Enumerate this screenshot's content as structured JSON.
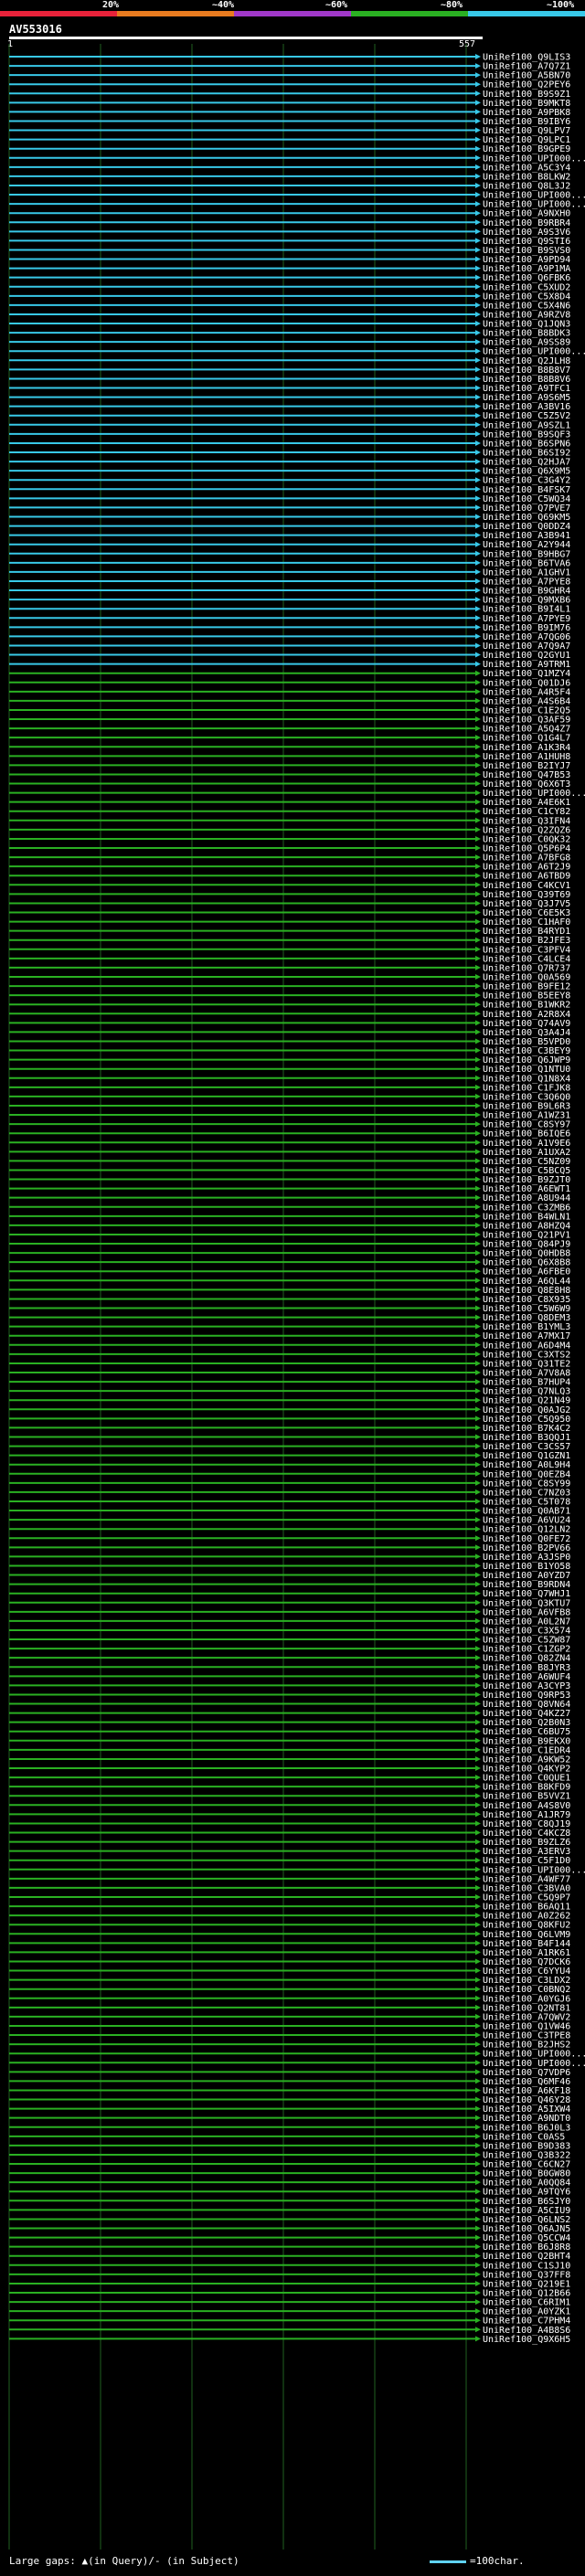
{
  "scale": {
    "labels": [
      "20%",
      "~40%",
      "~60%",
      "~80%",
      "~100%"
    ],
    "colors": [
      "#e8223a",
      "#e87b1f",
      "#a038c8",
      "#2ab022",
      "#38c8e8"
    ]
  },
  "query": {
    "name": "AV553016",
    "start": "1",
    "end": "557"
  },
  "legend": {
    "text": "Large gaps: ▲(in Query)/- (in Subject)",
    "scale_text": "=100char."
  },
  "chart_data": {
    "type": "alignment",
    "x_range": [
      1,
      557
    ],
    "blue_hits": [
      "UniRef100_Q9LIS3",
      "UniRef100_A7Q7Z1",
      "UniRef100_A5BN70",
      "UniRef100_Q2PEY6",
      "UniRef100_B9S9Z1",
      "UniRef100_B9MKT8",
      "UniRef100_A9PBK8",
      "UniRef100_B9IBY6",
      "UniRef100_Q9LPV7",
      "UniRef100_Q9LPC1",
      "UniRef100_B9GPE9",
      "UniRef100_UPI000...",
      "UniRef100_A5C3Y4",
      "UniRef100_B8LKW2",
      "UniRef100_Q8L3J2",
      "UniRef100_UPI000...",
      "UniRef100_UPI000...",
      "UniRef100_A9NXH0",
      "UniRef100_B9RBR4",
      "UniRef100_A9S3V6",
      "UniRef100_Q9STI6",
      "UniRef100_B9SVS0",
      "UniRef100_A9PD94",
      "UniRef100_A9P1MA",
      "UniRef100_Q6FBK6",
      "UniRef100_C5XUD2",
      "UniRef100_C5X8D4",
      "UniRef100_C5X4N6",
      "UniRef100_A9RZV8",
      "UniRef100_Q1JQN3",
      "UniRef100_B8BDK3",
      "UniRef100_A9SS89",
      "UniRef100_UPI000...",
      "UniRef100_Q2JLH8",
      "UniRef100_B8B8V7",
      "UniRef100_B8B8V6",
      "UniRef100_A9TFC1",
      "UniRef100_A9S6M5",
      "UniRef100_A3BV16",
      "UniRef100_C5Z5V2",
      "UniRef100_A9SZL1",
      "UniRef100_B9SQF3",
      "UniRef100_B6SPN6",
      "UniRef100_B6SI92",
      "UniRef100_Q2HJA7",
      "UniRef100_Q6X9M5",
      "UniRef100_C3G4Y2",
      "UniRef100_B4FSK7",
      "UniRef100_C5WQ34",
      "UniRef100_Q7PVE7",
      "UniRef100_Q69KM5",
      "UniRef100_Q0DDZ4",
      "UniRef100_A3B941",
      "UniRef100_A2Y944",
      "UniRef100_B9HBG7",
      "UniRef100_B6TVA6",
      "UniRef100_A1GHV1",
      "UniRef100_A7PYE8",
      "UniRef100_B9GHR4",
      "UniRef100_Q9MXB6",
      "UniRef100_B9I4L1",
      "UniRef100_A7PYE9",
      "UniRef100_B9IM76",
      "UniRef100_A7QG06",
      "UniRef100_A7Q9A7",
      "UniRef100_Q2GYU1",
      "UniRef100_A9TRM1"
    ],
    "green_hits": [
      "UniRef100_Q1MZY4",
      "UniRef100_Q01DJ6",
      "UniRef100_A4R5F4",
      "UniRef100_A4S6B4",
      "UniRef100_C1E2Q5",
      "UniRef100_Q3AF59",
      "UniRef100_A5Q4Z7",
      "UniRef100_Q1G4L7",
      "UniRef100_A1K3R4",
      "UniRef100_A1HUH8",
      "UniRef100_B2IYJ7",
      "UniRef100_Q47B53",
      "UniRef100_Q6X6T3",
      "UniRef100_UPI000...",
      "UniRef100_A4E6K1",
      "UniRef100_C1CY82",
      "UniRef100_Q3IFN4",
      "UniRef100_Q2ZQZ6",
      "UniRef100_C0QK32",
      "UniRef100_Q5P6P4",
      "UniRef100_A7BFG8",
      "UniRef100_A6T2J9",
      "UniRef100_A6TBD9",
      "UniRef100_C4KCV1",
      "UniRef100_Q39T69",
      "UniRef100_Q3J7V5",
      "UniRef100_C6E5K3",
      "UniRef100_C1HAF0",
      "UniRef100_B4RYD1",
      "UniRef100_B2JFE3",
      "UniRef100_C3PFV4",
      "UniRef100_C4LCE4",
      "UniRef100_Q7R737",
      "UniRef100_Q0A569",
      "UniRef100_B9FE12",
      "UniRef100_B5EEY8",
      "UniRef100_B1WKR2",
      "UniRef100_A2R8X4",
      "UniRef100_Q74AV9",
      "UniRef100_Q3A4J4",
      "UniRef100_B5VPD0",
      "UniRef100_C3BEY9",
      "UniRef100_Q6JWP9",
      "UniRef100_Q1NTU0",
      "UniRef100_Q1N8X4",
      "UniRef100_C1FJK8",
      "UniRef100_C3Q6Q0",
      "UniRef100_B9L6R3",
      "UniRef100_A1WZ31",
      "UniRef100_C8SY97",
      "UniRef100_B6IQE6",
      "UniRef100_A1V9E6",
      "UniRef100_A1UXA2",
      "UniRef100_C5NZ09",
      "UniRef100_C5BCQ5",
      "UniRef100_B9ZJT0",
      "UniRef100_A6EWT1",
      "UniRef100_A8U944",
      "UniRef100_C3ZMB6",
      "UniRef100_B4WLN1",
      "UniRef100_A8HZQ4",
      "UniRef100_Q21PV1",
      "UniRef100_Q84PJ9",
      "UniRef100_Q0HDB8",
      "UniRef100_Q6X8B8",
      "UniRef100_A6FBE0",
      "UniRef100_A6QL44",
      "UniRef100_Q8E8H8",
      "UniRef100_C8X935",
      "UniRef100_C5W6W9",
      "UniRef100_Q8DEM3",
      "UniRef100_B1YML3",
      "UniRef100_A7MX17",
      "UniRef100_A6D4M4",
      "UniRef100_C3XTS2",
      "UniRef100_Q31TE2",
      "UniRef100_A7V8A8",
      "UniRef100_B7HUP4",
      "UniRef100_Q7NLQ3",
      "UniRef100_Q21N49",
      "UniRef100_Q0AJG2",
      "UniRef100_C5Q950",
      "UniRef100_B7K4C2",
      "UniRef100_B3QQJ1",
      "UniRef100_C3CS57",
      "UniRef100_Q1GZN1",
      "UniRef100_A0L9H4",
      "UniRef100_Q0EZB4",
      "UniRef100_C8SY99",
      "UniRef100_C7NZ03",
      "UniRef100_C5T078",
      "UniRef100_Q0AB71",
      "UniRef100_A6VU24",
      "UniRef100_Q12LN2",
      "UniRef100_Q0FE72",
      "UniRef100_B2PV66",
      "UniRef100_A3JSP0",
      "UniRef100_B1YO58",
      "UniRef100_A0YZD7",
      "UniRef100_B9RDN4",
      "UniRef100_Q7WHJ1",
      "UniRef100_Q3KTU7",
      "UniRef100_A6VFB8",
      "UniRef100_A0L2N7",
      "UniRef100_C3X574",
      "UniRef100_C5ZW87",
      "UniRef100_C1ZGP2",
      "UniRef100_Q82ZN4",
      "UniRef100_B8JYR3",
      "UniRef100_A6WUF4",
      "UniRef100_A3CYP3",
      "UniRef100_Q9RP53",
      "UniRef100_Q8VN64",
      "UniRef100_Q4KZ27",
      "UniRef100_Q2B0N3",
      "UniRef100_C6BU75",
      "UniRef100_B9EKX0",
      "UniRef100_C1EDR4",
      "UniRef100_A9KW52",
      "UniRef100_Q4KYP2",
      "UniRef100_C0QUE1",
      "UniRef100_B8KFD9",
      "UniRef100_B5VVZ1",
      "UniRef100_A4S8V0",
      "UniRef100_A1JR79",
      "UniRef100_C8QJ19",
      "UniRef100_C4KCZ8",
      "UniRef100_B9ZLZ6",
      "UniRef100_A3ERV3",
      "UniRef100_C5F1D0",
      "UniRef100_UPI000...",
      "UniRef100_A4WF77",
      "UniRef100_C3BVA0",
      "UniRef100_C5Q9P7",
      "UniRef100_B6AQ11",
      "UniRef100_A0Z262",
      "UniRef100_Q8KFU2",
      "UniRef100_Q6LVM9",
      "UniRef100_B4F144",
      "UniRef100_A1RK61",
      "UniRef100_Q7DCK6",
      "UniRef100_C6YYU4",
      "UniRef100_C3LDX2",
      "UniRef100_C0BNQ2",
      "UniRef100_A0YGJ6",
      "UniRef100_Q2NT81",
      "UniRef100_A7QWV2",
      "UniRef100_Q1VW46",
      "UniRef100_C3TPE8",
      "UniRef100_B2JHS2",
      "UniRef100_UPI000...",
      "UniRef100_UPI000...",
      "UniRef100_Q7VDP6",
      "UniRef100_Q6MF46",
      "UniRef100_A6KF18",
      "UniRef100_Q46Y28",
      "UniRef100_A5IXW4",
      "UniRef100_A9NDT0",
      "UniRef100_B6J0L3",
      "UniRef100_C0AS5",
      "UniRef100_B9D383",
      "UniRef100_Q3B322",
      "UniRef100_C6CN27",
      "UniRef100_B0GW80",
      "UniRef100_A0QQ84",
      "UniRef100_A9TQY6",
      "UniRef100_B6SJY0",
      "UniRef100_A5CIU9",
      "UniRef100_Q6LNS2",
      "UniRef100_Q6AJN5",
      "UniRef100_Q5CCW4",
      "UniRef100_B6J8R8",
      "UniRef100_Q2BHT4",
      "UniRef100_C1SJ10",
      "UniRef100_Q37FF8",
      "UniRef100_Q219E1",
      "UniRef100_Q12B66",
      "UniRef100_C6RIM1",
      "UniRef100_A0YZK1",
      "UniRef100_C7PHM4",
      "UniRef100_A4B8S6",
      "UniRef100_Q9X6H5"
    ]
  }
}
